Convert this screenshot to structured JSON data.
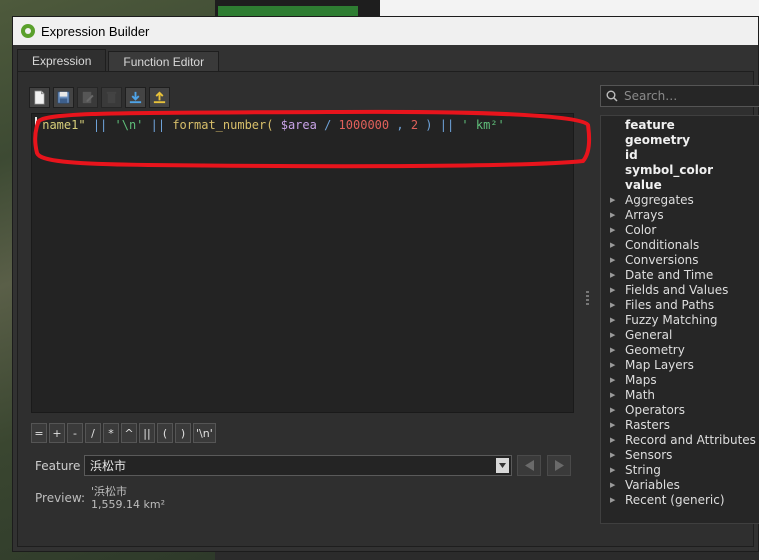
{
  "window": {
    "title": "Expression Builder"
  },
  "tabs": [
    {
      "label": "Expression"
    },
    {
      "label": "Function Editor"
    }
  ],
  "toolbar": {
    "icons": [
      "new-file-icon",
      "save-icon",
      "edit-icon",
      "delete-icon",
      "import-icon",
      "export-icon"
    ]
  },
  "editor": {
    "tokens": [
      {
        "text": "\"name1\"",
        "kind": "field"
      },
      {
        "text": " ",
        "kind": "plain"
      },
      {
        "text": "||",
        "kind": "op"
      },
      {
        "text": " ",
        "kind": "plain"
      },
      {
        "text": "'\\n'",
        "kind": "str"
      },
      {
        "text": " ",
        "kind": "plain"
      },
      {
        "text": "||",
        "kind": "op"
      },
      {
        "text": " ",
        "kind": "plain"
      },
      {
        "text": "format_number(",
        "kind": "func"
      },
      {
        "text": " ",
        "kind": "plain"
      },
      {
        "text": "$area",
        "kind": "var"
      },
      {
        "text": " ",
        "kind": "plain"
      },
      {
        "text": "/",
        "kind": "op"
      },
      {
        "text": " ",
        "kind": "plain"
      },
      {
        "text": "1000000",
        "kind": "num"
      },
      {
        "text": " , ",
        "kind": "op"
      },
      {
        "text": "2",
        "kind": "num"
      },
      {
        "text": " ) ",
        "kind": "op"
      },
      {
        "text": "||",
        "kind": "op"
      },
      {
        "text": " ",
        "kind": "plain"
      },
      {
        "text": "' km²'",
        "kind": "str"
      }
    ]
  },
  "operators": [
    "=",
    "+",
    "-",
    "/",
    "*",
    "^",
    "||",
    "(",
    ")",
    "'\\n'"
  ],
  "feature": {
    "label": "Feature",
    "value": "浜松市"
  },
  "preview": {
    "label": "Preview:",
    "line1": "'浜松市",
    "line2": "1,559.14 km²"
  },
  "search": {
    "placeholder": "Search…"
  },
  "function_tree": [
    {
      "label": "feature",
      "bold": true,
      "expandable": false
    },
    {
      "label": "geometry",
      "bold": true,
      "expandable": false
    },
    {
      "label": "id",
      "bold": true,
      "expandable": false
    },
    {
      "label": "symbol_color",
      "bold": true,
      "expandable": false
    },
    {
      "label": "value",
      "bold": true,
      "expandable": false
    },
    {
      "label": "Aggregates",
      "bold": false,
      "expandable": true
    },
    {
      "label": "Arrays",
      "bold": false,
      "expandable": true
    },
    {
      "label": "Color",
      "bold": false,
      "expandable": true
    },
    {
      "label": "Conditionals",
      "bold": false,
      "expandable": true
    },
    {
      "label": "Conversions",
      "bold": false,
      "expandable": true
    },
    {
      "label": "Date and Time",
      "bold": false,
      "expandable": true
    },
    {
      "label": "Fields and Values",
      "bold": false,
      "expandable": true
    },
    {
      "label": "Files and Paths",
      "bold": false,
      "expandable": true
    },
    {
      "label": "Fuzzy Matching",
      "bold": false,
      "expandable": true
    },
    {
      "label": "General",
      "bold": false,
      "expandable": true
    },
    {
      "label": "Geometry",
      "bold": false,
      "expandable": true
    },
    {
      "label": "Map Layers",
      "bold": false,
      "expandable": true
    },
    {
      "label": "Maps",
      "bold": false,
      "expandable": true
    },
    {
      "label": "Math",
      "bold": false,
      "expandable": true
    },
    {
      "label": "Operators",
      "bold": false,
      "expandable": true
    },
    {
      "label": "Rasters",
      "bold": false,
      "expandable": true
    },
    {
      "label": "Record and Attributes",
      "bold": false,
      "expandable": true
    },
    {
      "label": "Sensors",
      "bold": false,
      "expandable": true
    },
    {
      "label": "String",
      "bold": false,
      "expandable": true
    },
    {
      "label": "Variables",
      "bold": false,
      "expandable": true
    },
    {
      "label": "Recent (generic)",
      "bold": false,
      "expandable": true
    }
  ],
  "colors": {
    "annotation_red": "#e8141c",
    "syntax_field": "#d7cf7a",
    "syntax_string": "#5fbf7a",
    "syntax_number": "#e0605a",
    "syntax_operator": "#6ea2d8"
  }
}
